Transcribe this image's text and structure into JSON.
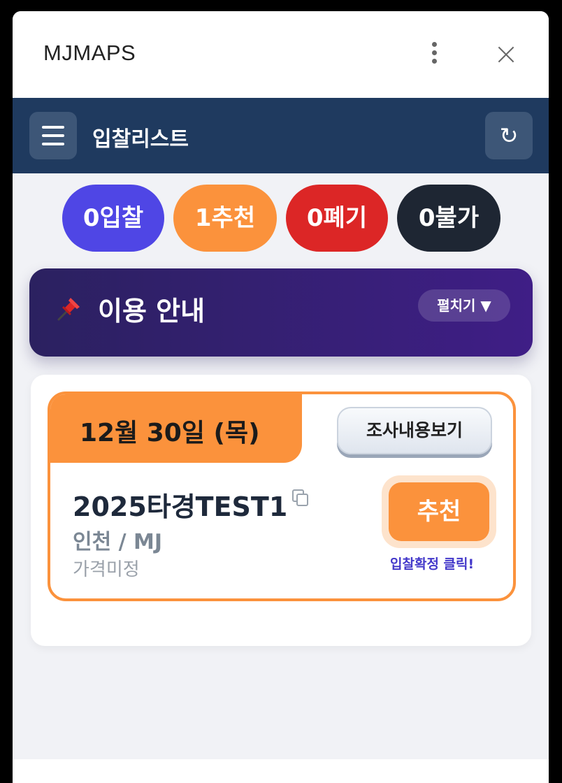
{
  "app": {
    "title": "MJMAPS"
  },
  "navbar": {
    "title": "입찰리스트",
    "refresh_icon": "↻"
  },
  "pills": [
    {
      "label": "0입찰",
      "color": "#4f46e5"
    },
    {
      "label": "1추천",
      "color": "#fb923c"
    },
    {
      "label": "0폐기",
      "color": "#dc2626"
    },
    {
      "label": "0불가",
      "color": "#1e2633"
    }
  ],
  "guide": {
    "title": "이용 안내",
    "expand_label": "펼치기 ▼",
    "icon": "pushpin-icon"
  },
  "item": {
    "date": "12월 30일 (목)",
    "survey_label": "조사내용보기",
    "title": "2025타경TEST1",
    "subtitle": "인천 / MJ",
    "price": "가격미정",
    "status_button": "추천",
    "hint": "입찰확정 클릭!"
  },
  "colors": {
    "accent": "#fb923c",
    "navbar": "#1f3a5f",
    "guide_start": "#2b2160",
    "guide_end": "#3f1e86"
  }
}
